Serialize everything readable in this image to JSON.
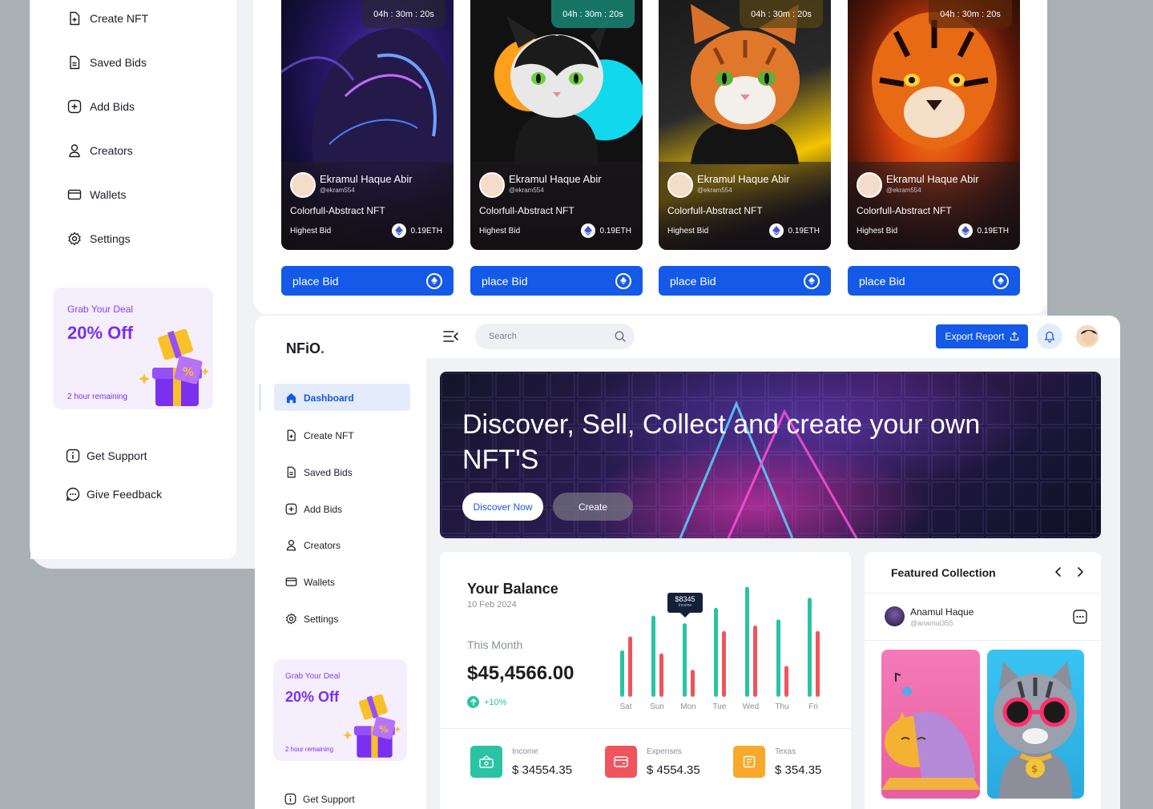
{
  "back": {
    "nav": [
      {
        "label": "Create NFT",
        "icon": "plus-file-icon"
      },
      {
        "label": "Saved Bids",
        "icon": "file-icon"
      },
      {
        "label": "Add Bids",
        "icon": "plus-square-icon"
      },
      {
        "label": "Creators",
        "icon": "user-icon"
      },
      {
        "label": "Wallets",
        "icon": "wallet-icon"
      },
      {
        "label": "Settings",
        "icon": "gear-icon"
      }
    ],
    "promo": {
      "small": "Grab Your Deal",
      "big": "20% Off",
      "remaining": "2 hour remaining"
    },
    "support": "Get Support",
    "feedback": "Give Feedback",
    "cards": [
      {
        "timer": "04h : 30m : 20s",
        "owner": "Ekramul Haque Abir",
        "handle": "@ekram554",
        "title": "Colorfull-Abstract NFT",
        "highest": "Highest Bid",
        "price": "0.19ETH",
        "button": "place Bid"
      },
      {
        "timer": "04h : 30m : 20s",
        "owner": "Ekramul Haque Abir",
        "handle": "@ekram554",
        "title": "Colorfull-Abstract NFT",
        "highest": "Highest Bid",
        "price": "0.19ETH",
        "button": "place Bid"
      },
      {
        "timer": "04h : 30m : 20s",
        "owner": "Ekramul Haque Abir",
        "handle": "@ekram554",
        "title": "Colorfull-Abstract NFT",
        "highest": "Highest Bid",
        "price": "0.19ETH",
        "button": "place Bid"
      },
      {
        "timer": "04h : 30m : 20s",
        "owner": "Ekramul Haque Abir",
        "handle": "@ekram554",
        "title": "Colorfull-Abstract NFT",
        "highest": "Highest Bid",
        "price": "0.19ETH",
        "button": "place Bid"
      }
    ]
  },
  "front": {
    "logo": "NFiO",
    "nav": [
      {
        "label": "Dashboard",
        "active": true
      },
      {
        "label": "Create NFT"
      },
      {
        "label": "Saved Bids"
      },
      {
        "label": "Add Bids"
      },
      {
        "label": "Creators"
      },
      {
        "label": "Wallets"
      },
      {
        "label": "Settings"
      }
    ],
    "promo": {
      "small": "Grab Your Deal",
      "big": "20% Off",
      "remaining": "2 hour remaining"
    },
    "support": "Get Support",
    "search_placeholder": "Search",
    "export_label": "Export Report",
    "hero": {
      "title": "Discover, Sell, Collect and create your own NFT'S",
      "discover": "Discover Now",
      "create": "Create"
    },
    "balance": {
      "title": "Your Balance",
      "date": "10 Feb 2024",
      "month_label": "This Month",
      "amount": "$45,4566.00",
      "change": "+10%",
      "tooltip_value": "$8345",
      "tooltip_label": "Income"
    },
    "stats": [
      {
        "label": "Income",
        "value": "$ 34554.35",
        "color": "#2ac3a3"
      },
      {
        "label": "Expenses",
        "value": "$ 4554.35",
        "color": "#f0545c"
      },
      {
        "label": "Texas",
        "value": "$ 354.35",
        "color": "#f8a92b"
      }
    ],
    "featured": {
      "title": "Featured Collection",
      "user": "Anamul Haque",
      "handle": "@anamul355"
    }
  },
  "chart_data": {
    "type": "bar",
    "categories": [
      "Sat",
      "Sun",
      "Mon",
      "Tue",
      "Wed",
      "Thu",
      "Fri"
    ],
    "series": [
      {
        "name": "Income",
        "values": [
          60,
          105,
          95,
          115,
          142,
          100,
          128
        ]
      },
      {
        "name": "Expenses",
        "values": [
          78,
          56,
          35,
          85,
          92,
          40,
          85
        ]
      }
    ],
    "colors": {
      "Income": "#2ac3a3",
      "Expenses": "#f0545c"
    },
    "ylim": [
      0,
      150
    ]
  }
}
